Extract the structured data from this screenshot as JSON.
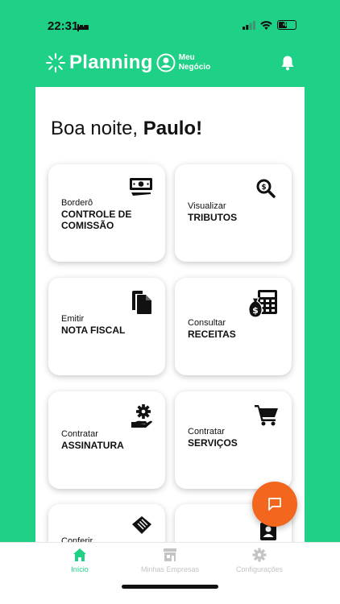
{
  "status_bar": {
    "time": "22:31",
    "battery": "42"
  },
  "brand": {
    "name": "Planning",
    "sub_line1": "Meu",
    "sub_line2": "Negócio"
  },
  "greeting": {
    "prefix": "Boa noite, ",
    "name": "Paulo!"
  },
  "tiles": [
    {
      "small": "Borderô",
      "big_line1": "CONTROLE DE",
      "big_line2": "COMISSÃO",
      "icon": "cash-icon"
    },
    {
      "small": "Visualizar",
      "big_line1": "TRIBUTOS",
      "big_line2": "",
      "icon": "search-dollar-icon"
    },
    {
      "small": "Emitir",
      "big_line1": "NOTA FISCAL",
      "big_line2": "",
      "icon": "copy-icon"
    },
    {
      "small": "Consultar",
      "big_line1": "RECEITAS",
      "big_line2": "",
      "icon": "money-calculator-icon"
    },
    {
      "small": "Contratar",
      "big_line1": "ASSINATURA",
      "big_line2": "",
      "icon": "hand-gear-icon"
    },
    {
      "small": "Contratar",
      "big_line1": "SERVIÇOS",
      "big_line2": "",
      "icon": "cart-icon"
    },
    {
      "small": "Conferir",
      "big_line1": "",
      "big_line2": "",
      "icon": "handshake-icon"
    },
    {
      "small": "",
      "big_line1": "",
      "big_line2": "",
      "icon": "id-badge-icon"
    }
  ],
  "nav": [
    {
      "label": "Início",
      "icon": "home-icon",
      "active": true
    },
    {
      "label": "Minhas Empresas",
      "icon": "store-icon",
      "active": false
    },
    {
      "label": "Configurações",
      "icon": "gear-icon",
      "active": false
    }
  ],
  "colors": {
    "brand": "#1fd186",
    "fab": "#f2661e",
    "nav_inactive": "#c4c4c4"
  }
}
